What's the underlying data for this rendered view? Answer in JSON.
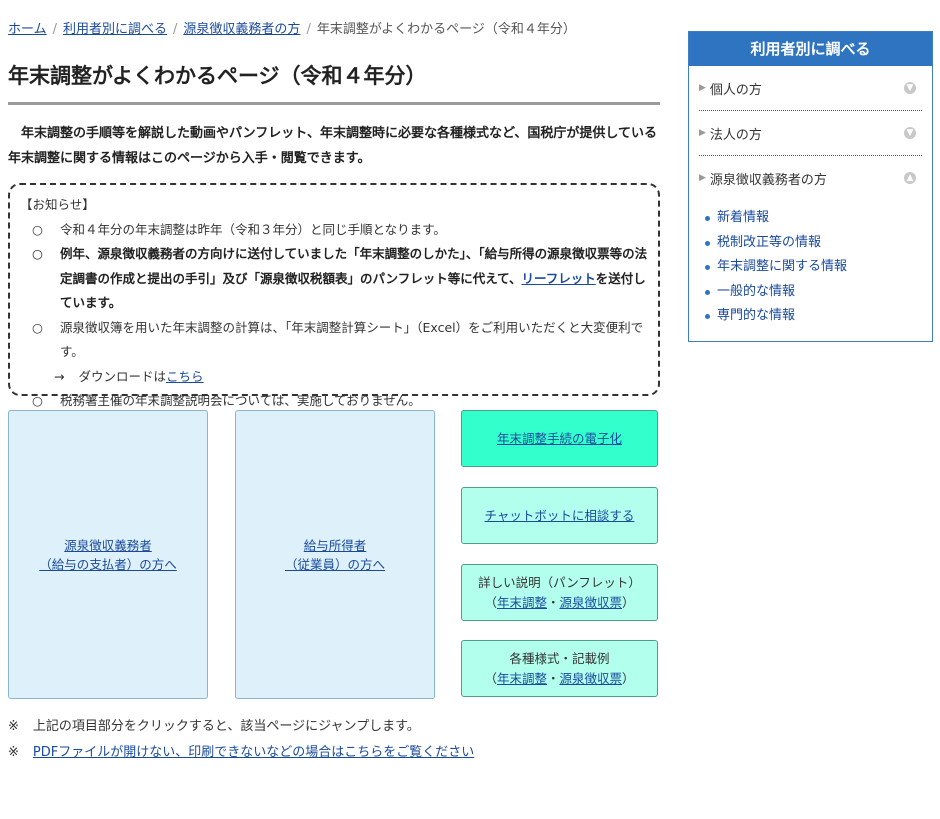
{
  "breadcrumb": {
    "home": "ホーム",
    "by_user": "利用者別に調べる",
    "withholding": "源泉徴収義務者の方",
    "current": "年末調整がよくわかるページ（令和４年分）"
  },
  "page_title": "年末調整がよくわかるページ（令和４年分）",
  "intro": "年末調整の手順等を解説した動画やパンフレット、年末調整時に必要な各種様式など、国税庁が提供している年末調整に関する情報はこのページから入手・閲覧できます。",
  "notice": {
    "header": "【お知らせ】",
    "mark": "○",
    "item1": "令和４年分の年末調整は昨年（令和３年分）と同じ手順となります。",
    "item2_pre": "例年、源泉徴収義務者の方向けに送付していました「年末調整のしかた」、「給与所得の源泉徴収票等の法定調書の作成と提出の手引」及び「源泉徴収税額表」のパンフレット等に代えて、",
    "item2_link": "リーフレット",
    "item2_post": "を送付しています。",
    "item3": "源泉徴収簿を用いた年末調整の計算は、「年末調整計算シート」（Excel）をご利用いただくと大変便利です。",
    "arrow": "→",
    "download_pre": "ダウンロードは",
    "download_link": "こちら",
    "item4": "税務署主催の年末調整説明会については、実施しておりません。"
  },
  "tiles": {
    "payer_line1": "源泉徴収義務者",
    "payer_line2": "（給与の支払者）の方へ",
    "employee_line1": "給与所得者",
    "employee_line2": "（従業員）の方へ",
    "digitization": "年末調整手続の電子化",
    "chatbot": "チャットボットに相談する",
    "pamphlet_title": "詳しい説明（パンフレット）",
    "forms_title": "各種様式・記載例",
    "open_paren": "（",
    "close_paren": "）",
    "dot": "・",
    "link_year_end": "年末調整",
    "link_withholding_slip": "源泉徴収票"
  },
  "footnotes": {
    "mark": "※",
    "note1": "上記の項目部分をクリックすると、該当ページにジャンプします。",
    "note2": "PDFファイルが開けない、印刷できないなどの場合はこちらをご覧ください"
  },
  "sidebar": {
    "title": "利用者別に調べる",
    "individual": "個人の方",
    "corporation": "法人の方",
    "withholding": "源泉徴収義務者の方",
    "sub_items": [
      "新着情報",
      "税制改正等の情報",
      "年末調整に関する情報",
      "一般的な情報",
      "専門的な情報"
    ]
  },
  "colors": {
    "sidebar_header": "#2f74c0",
    "tile_blue": "#def1fb",
    "tile_mint": "#b3ffee",
    "tile_active": "#33ffcc"
  },
  "icons": {
    "collapsed": "triangle-right-icon",
    "expand": "circle-down-icon",
    "collapse": "circle-up-icon"
  }
}
